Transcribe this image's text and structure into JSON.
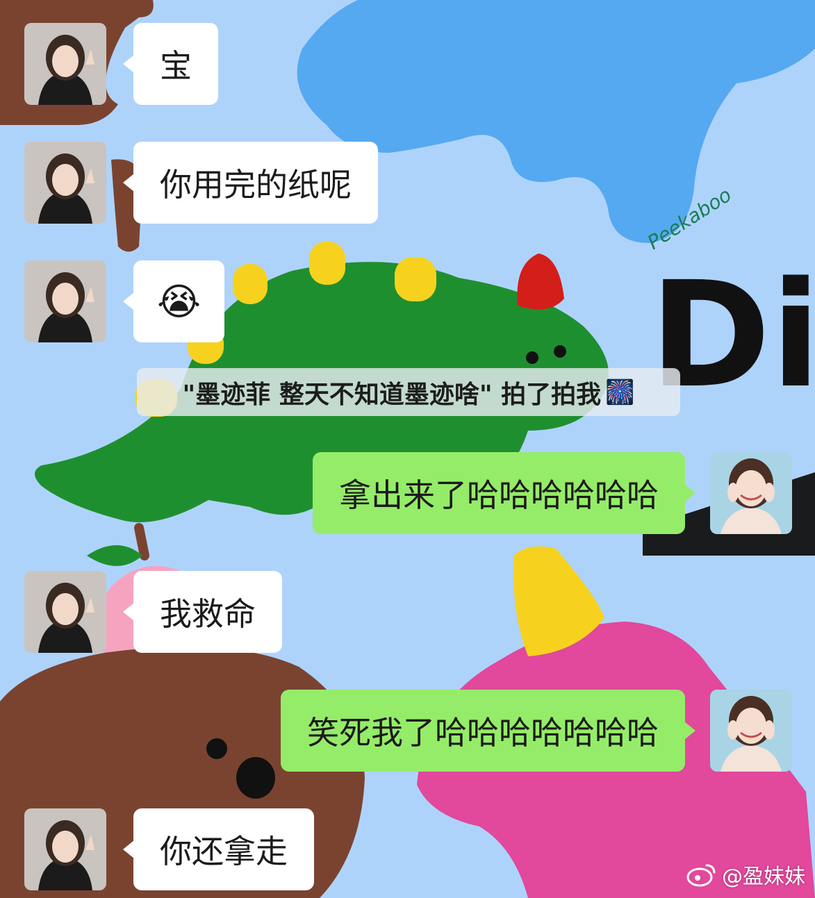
{
  "chat": {
    "messages": [
      {
        "side": "in",
        "text": "宝"
      },
      {
        "side": "in",
        "text": "你用完的纸呢"
      },
      {
        "side": "in",
        "emoji": "😭"
      },
      {
        "side": "in",
        "text": "我救命"
      },
      {
        "side": "out",
        "text": "拿出来了哈哈哈哈哈哈"
      },
      {
        "side": "out",
        "text": "笑死我了哈哈哈哈哈哈哈"
      },
      {
        "side": "in",
        "text": "你还拿走"
      }
    ],
    "pat_notice": {
      "text": "\"墨迹菲 整天不知道墨迹啥\" 拍了拍我",
      "icon": "firework-emoji"
    }
  },
  "wallpaper": {
    "caption": "Peekaboo",
    "big_letters": "Di",
    "colors": {
      "sky": "#aed3fb",
      "blue_blob": "#55a9f0",
      "green_dino": "#1e8f2f",
      "dino_spikes": "#f6d21f",
      "red_horn": "#d31e19",
      "pink_dino": "#e2489b",
      "brown_bear": "#7a4330",
      "pink_apple": "#f6a3c0",
      "outgoing_bubble": "#95ec69",
      "incoming_bubble": "#ffffff"
    }
  },
  "watermark": {
    "label": "@盈妹妹",
    "icon": "weibo-icon"
  }
}
